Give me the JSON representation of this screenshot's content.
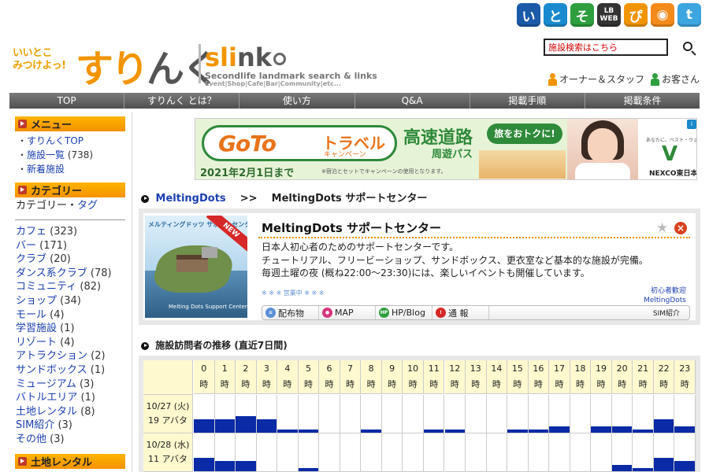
{
  "social": [
    {
      "name": "itoshi-icon",
      "label": "い",
      "color": "#1a5aa8"
    },
    {
      "name": "topic-icon",
      "label": "と",
      "color": "#1a8ad0"
    },
    {
      "name": "sokuho-icon",
      "label": "そ",
      "color": "#2e9e3e"
    },
    {
      "name": "lbweb-icon",
      "label": "LB WEB",
      "color": "#333333"
    },
    {
      "name": "pi-icon",
      "label": "ぴ",
      "color": "#f29400"
    },
    {
      "name": "rss-icon",
      "label": "◉",
      "color": "#f48a1c"
    },
    {
      "name": "twitter-icon",
      "label": "t",
      "color": "#3da5e0"
    }
  ],
  "logo": {
    "tagline": "いいとこ\nみつけよっ!",
    "main_a": "すり",
    "main_b": "んく",
    "slink_a": "sli",
    "slink_b": "nk",
    "sub1": "Secondlife landmark search & links",
    "sub2": "Event|Shop|Cafe|Bar|Community|etc..."
  },
  "search": {
    "value": "施設検索はこちら"
  },
  "user_links": [
    {
      "label": "オーナー＆スタッフ",
      "color": "#f29400"
    },
    {
      "label": "お客さん",
      "color": "#2e9e3e"
    }
  ],
  "nav": [
    "TOP",
    "すりんく とは？",
    "使い方",
    "Q&A",
    "掲載手順",
    "掲載条件"
  ],
  "sidebar": {
    "menu_title": "メニュー",
    "menu_items": [
      {
        "prefix": "・",
        "label": "すりんくTOP",
        "count": ""
      },
      {
        "prefix": "・",
        "label": "施設一覧",
        "count": " (738)"
      },
      {
        "prefix": "・",
        "label": "新着施設",
        "count": ""
      }
    ],
    "category_title": "カテゴリー",
    "category_tag_a": "カテゴリー",
    "category_tag_sep": "・",
    "category_tag_b": "タグ",
    "categories": [
      {
        "label": "カフェ",
        "count": " (323)"
      },
      {
        "label": "バー",
        "count": " (171)"
      },
      {
        "label": "クラブ",
        "count": " (20)"
      },
      {
        "label": "ダンス系クラブ",
        "count": " (78)"
      },
      {
        "label": "コミュニティ",
        "count": " (82)"
      },
      {
        "label": "ショップ",
        "count": " (34)"
      },
      {
        "label": "モール",
        "count": " (4)"
      },
      {
        "label": "学習施設",
        "count": " (1)"
      },
      {
        "label": "リゾート",
        "count": " (4)"
      },
      {
        "label": "アトラクション",
        "count": " (2)"
      },
      {
        "label": "サンドボックス",
        "count": " (1)"
      },
      {
        "label": "ミュージアム",
        "count": " (3)"
      },
      {
        "label": "バトルエリア",
        "count": " (1)"
      },
      {
        "label": "土地レンタル",
        "count": " (8)"
      },
      {
        "label": "SIM紹介",
        "count": " (3)"
      },
      {
        "label": "その他",
        "count": " (3)"
      }
    ],
    "land_title": "土地レンタル"
  },
  "banner": {
    "goto": "GoTo",
    "travel": "トラベル",
    "campaign": "キャンペーン",
    "highway": "高速道路",
    "pass": "周遊パス",
    "date": "2021年2月1日まで",
    "note": "※宿泊とセットでキャンペーンの使用となります。",
    "bubble": "旅をおトクに!",
    "nexco_small": "あなたに、ベスト・ウェイ。",
    "nexco_logo": "V",
    "nexco_name": "NEXCO東日本",
    "ad": "i"
  },
  "breadcrumb": {
    "link": "MeltingDots",
    "sep": ">>",
    "current": "MeltingDots サポートセンター"
  },
  "facility": {
    "thumb_caption": "メルティングドッツ  サポートセンター",
    "thumb_foot": "Melting Dots Support Center",
    "new_label": "NEW",
    "title": "MeltingDots サポートセンター",
    "description": [
      "日本人初心者のためのサポートセンターです。",
      "チュートリアル、フリービーショップ、サンドボックス、更衣室など基本的な施設が完備。",
      "毎週土曜の夜 (概ね22:00～23:30)には、楽しいイベントも開催しています。"
    ],
    "status": "※ ※ ※ 営業中 ※ ※ ※",
    "tags": [
      "初心者歓迎",
      "MeltingDots"
    ],
    "links": [
      {
        "label": "配布物",
        "icon": "gift-icon",
        "color": "#5b8fd6",
        "glyph": "≡"
      },
      {
        "label": "MAP",
        "icon": "map-pin-icon",
        "color": "#d6337d",
        "glyph": "●"
      },
      {
        "label": "HP/Blog",
        "icon": "hp-icon",
        "color": "#2e9e3e",
        "glyph": "HP"
      },
      {
        "label": "通 報",
        "icon": "alert-icon",
        "color": "#d62828",
        "glyph": "!"
      }
    ],
    "sim_label": "SIM紹介"
  },
  "visitors": {
    "title": "施設訪問者の推移 (直近7日間)",
    "hour_unit": "時",
    "hours": [
      "0",
      "1",
      "2",
      "3",
      "4",
      "5",
      "6",
      "7",
      "8",
      "9",
      "10",
      "11",
      "12",
      "13",
      "14",
      "15",
      "16",
      "17",
      "18",
      "19",
      "20",
      "21",
      "22",
      "23"
    ],
    "rows": [
      {
        "date": "10/27 (火)",
        "avatars": "19 アバタ",
        "values": [
          2,
          2,
          2.5,
          2,
          0,
          0,
          0,
          0,
          0,
          0,
          0,
          0,
          0,
          0,
          0,
          0,
          0,
          0,
          0,
          0,
          0,
          0,
          0,
          0
        ]
      },
      {
        "date": "10/28 (水)",
        "avatars": "11 アバタ",
        "values": [
          2,
          1.5,
          1.5,
          0,
          0,
          0,
          0,
          0,
          0,
          0,
          0,
          0,
          0,
          0,
          0,
          0,
          0,
          0,
          0,
          0,
          0,
          0,
          0,
          0
        ]
      }
    ]
  },
  "chart_data": {
    "type": "heatmap",
    "title": "施設訪問者の推移 (直近7日間)",
    "x": [
      "0",
      "1",
      "2",
      "3",
      "4",
      "5",
      "6",
      "7",
      "8",
      "9",
      "10",
      "11",
      "12",
      "13",
      "14",
      "15",
      "16",
      "17",
      "18",
      "19",
      "20",
      "21",
      "22",
      "23"
    ],
    "series": [
      {
        "name": "10/27 (火)",
        "values": [
          2,
          2,
          2.5,
          2,
          0.5,
          0.5,
          0,
          0,
          0.5,
          0,
          0,
          0.5,
          0.5,
          0,
          0,
          0.5,
          0.5,
          1,
          0,
          1,
          1,
          0.5,
          2,
          1
        ]
      },
      {
        "name": "10/28 (水)",
        "values": [
          2,
          1.5,
          1.5,
          0,
          0,
          0.5,
          0,
          0,
          0,
          0,
          0,
          0,
          0,
          0,
          0,
          0,
          0,
          0,
          0,
          0,
          1,
          0.5,
          2,
          1.5
        ]
      }
    ],
    "ylim": [
      0,
      10
    ]
  }
}
